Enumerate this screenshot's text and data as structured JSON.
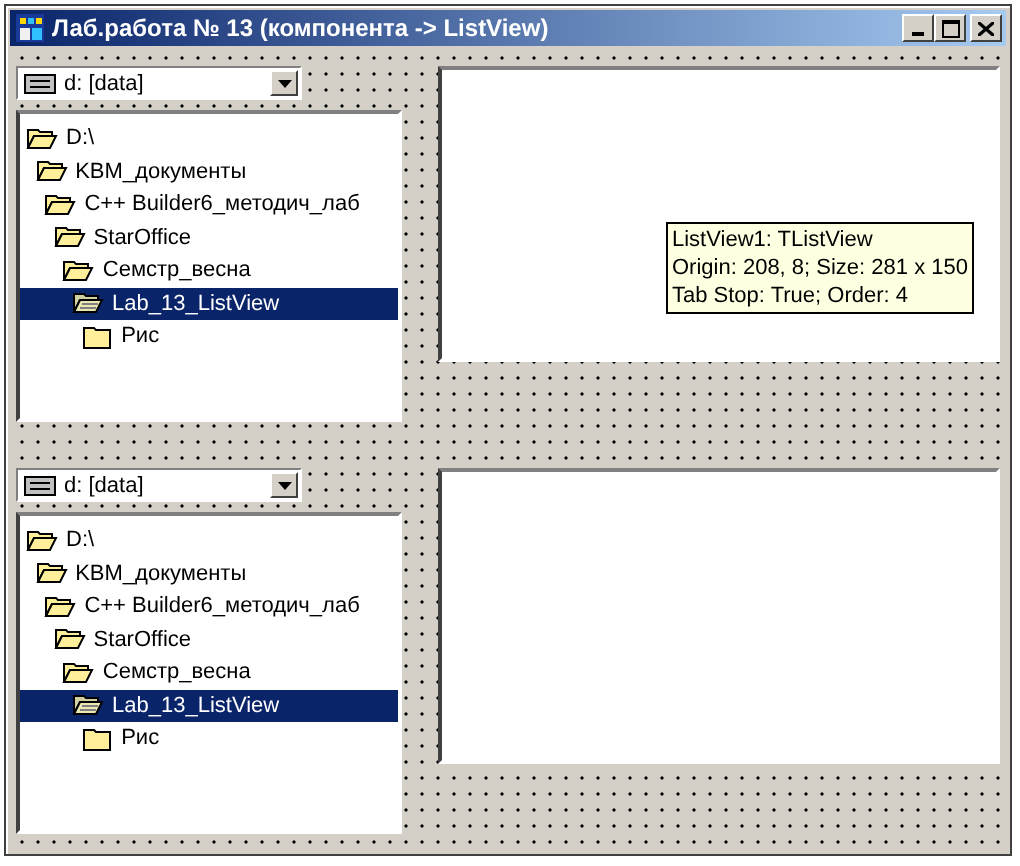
{
  "window": {
    "title": "Лаб.работа № 13 (компонента -> ListView)"
  },
  "panels": [
    {
      "drive_combo": {
        "value": "d: [data]"
      },
      "tree": [
        {
          "label": "D:\\",
          "expanded": true,
          "selected": false,
          "children": [
            {
              "label": "KBM_документы",
              "expanded": true,
              "selected": false,
              "children": [
                {
                  "label": "C++ Builder6_методич_лаб",
                  "expanded": true,
                  "selected": false,
                  "children": [
                    {
                      "label": "StarOffice",
                      "expanded": true,
                      "selected": false,
                      "children": [
                        {
                          "label": "Семстр_весна",
                          "expanded": true,
                          "selected": false,
                          "children": [
                            {
                              "label": "Lab_13_ListView",
                              "expanded": true,
                              "selected": true,
                              "children": [
                                {
                                  "label": "Рис",
                                  "expanded": false,
                                  "selected": false
                                }
                              ]
                            }
                          ]
                        }
                      ]
                    }
                  ]
                }
              ]
            }
          ]
        }
      ],
      "list_view": {
        "tooltip": [
          "ListView1: TListView",
          "Origin: 208, 8; Size: 281 x 150",
          "Tab Stop: True; Order: 4"
        ]
      }
    },
    {
      "drive_combo": {
        "value": "d: [data]"
      },
      "tree": [
        {
          "label": "D:\\",
          "expanded": true,
          "selected": false,
          "children": [
            {
              "label": "KBM_документы",
              "expanded": true,
              "selected": false,
              "children": [
                {
                  "label": "C++ Builder6_методич_лаб",
                  "expanded": true,
                  "selected": false,
                  "children": [
                    {
                      "label": "StarOffice",
                      "expanded": true,
                      "selected": false,
                      "children": [
                        {
                          "label": "Семстр_весна",
                          "expanded": true,
                          "selected": false,
                          "children": [
                            {
                              "label": "Lab_13_ListView",
                              "expanded": true,
                              "selected": true,
                              "children": [
                                {
                                  "label": "Рис",
                                  "expanded": false,
                                  "selected": false
                                }
                              ]
                            }
                          ]
                        }
                      ]
                    }
                  ]
                }
              ]
            }
          ]
        }
      ]
    }
  ]
}
